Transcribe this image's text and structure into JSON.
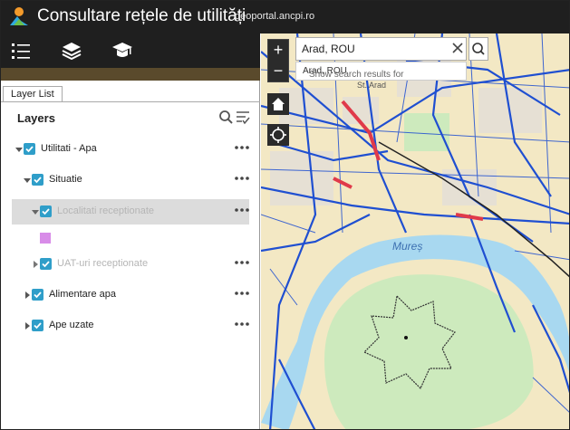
{
  "header": {
    "title": "Consultare rețele de utilități",
    "url": "geoportal.ancpi.ro"
  },
  "toolbar": {
    "items": [
      {
        "icon": "list-icon"
      },
      {
        "icon": "layers-icon"
      },
      {
        "icon": "graduation-cap-icon"
      }
    ]
  },
  "panel": {
    "tab_label": "Layer List",
    "heading": "Layers"
  },
  "layers": [
    {
      "label": "Utilitati - Apa",
      "checked": true,
      "expanded": true,
      "level": 0,
      "dimmed": false
    },
    {
      "label": "Situatie",
      "checked": true,
      "expanded": true,
      "level": 1,
      "dimmed": false
    },
    {
      "label": "Localitati receptionate",
      "checked": true,
      "expanded": true,
      "level": 2,
      "dimmed": true,
      "selected": true,
      "legend_color": "#d88ce8"
    },
    {
      "label": "UAT-uri receptionate",
      "checked": true,
      "expanded": false,
      "level": 2,
      "dimmed": true
    },
    {
      "label": "Alimentare apa",
      "checked": true,
      "expanded": false,
      "level": 1,
      "dimmed": false
    },
    {
      "label": "Ape uzate",
      "checked": true,
      "expanded": false,
      "level": 1,
      "dimmed": false
    }
  ],
  "search": {
    "value": "Arad, ROU",
    "suggestion_prefix": "Show search results for ",
    "suggestion_term": "Arad, ROU"
  },
  "map": {
    "zoom_in": "+",
    "zoom_out": "−",
    "river_label": "Mureș",
    "district_label": "St. Arad"
  },
  "colors": {
    "header_bg": "#1f1f1f",
    "checkbox": "#2f9ec9",
    "network_lines": "#1f4fd1",
    "map_base": "#f5ebc9",
    "park": "#cdeabd",
    "river": "#a8d8f0"
  }
}
